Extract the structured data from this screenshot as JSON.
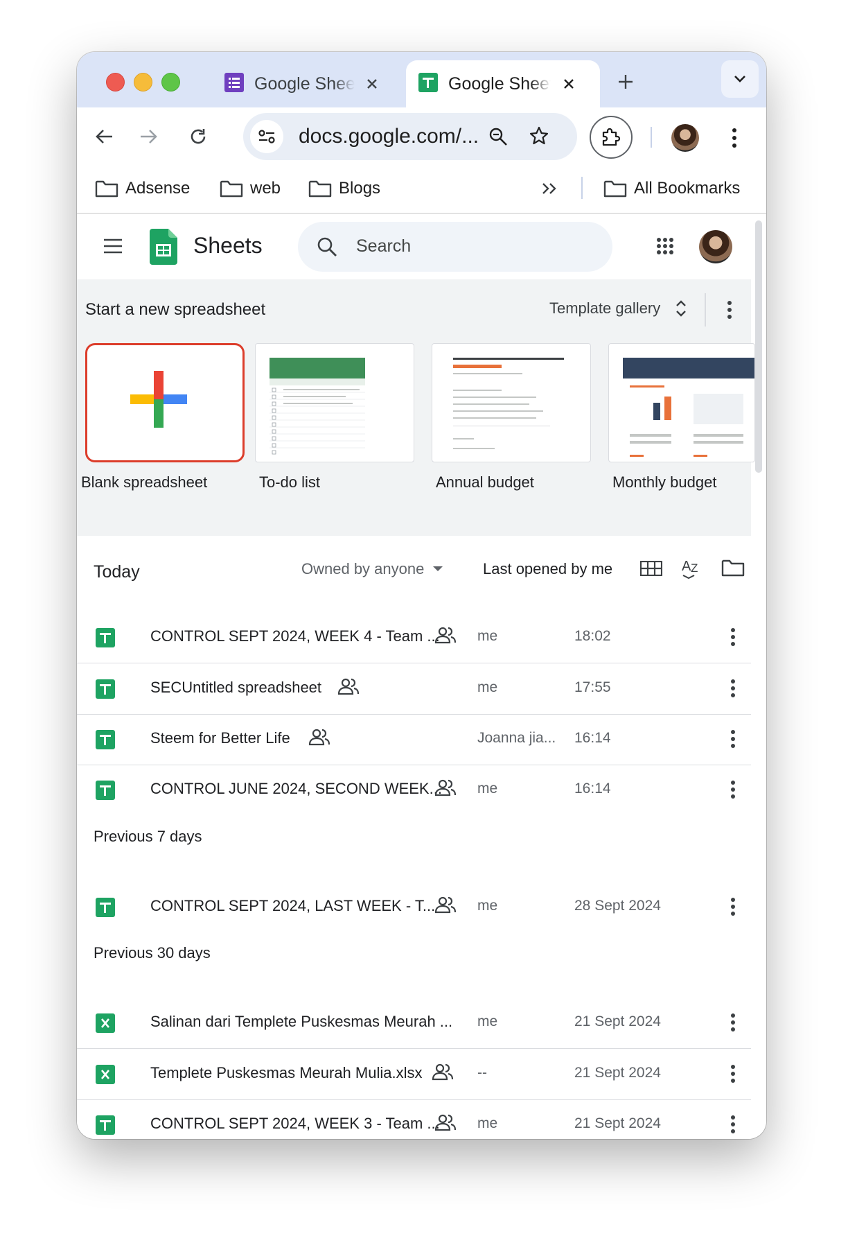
{
  "tabs": [
    {
      "title": "Google Sheets",
      "icon": "google-forms-icon",
      "active": false
    },
    {
      "title": "Google Sheets",
      "icon": "google-sheets-icon",
      "active": true
    }
  ],
  "toolbar": {
    "url": "docs.google.com/..."
  },
  "bookmarks": {
    "items": [
      "Adsense",
      "web",
      "Blogs"
    ],
    "all_bookmarks": "All Bookmarks"
  },
  "app": {
    "name": "Sheets",
    "search_placeholder": "Search"
  },
  "templates": {
    "title": "Start a new spreadsheet",
    "gallery_label": "Template gallery",
    "items": [
      {
        "label": "Blank spreadsheet"
      },
      {
        "label": "To-do list"
      },
      {
        "label": "Annual budget"
      },
      {
        "label": "Monthly budget"
      }
    ]
  },
  "filters": {
    "section": "Today",
    "owned": "Owned by anyone",
    "sort": "Last opened by me"
  },
  "files": {
    "today": [
      {
        "name": "CONTROL SEPT 2024, WEEK 4 - Team ...",
        "owner": "me",
        "opened": "18:02",
        "type": "sheet",
        "shared": true
      },
      {
        "name": "SECUntitled spreadsheet",
        "owner": "me",
        "opened": "17:55",
        "type": "sheet",
        "shared": true
      },
      {
        "name": "Steem for Better Life",
        "owner": "Joanna jia...",
        "opened": "16:14",
        "type": "sheet",
        "shared": true
      },
      {
        "name": "CONTROL JUNE 2024, SECOND WEEK...",
        "owner": "me",
        "opened": "16:14",
        "type": "sheet",
        "shared": true
      }
    ],
    "prev7_label": "Previous 7 days",
    "prev7": [
      {
        "name": "CONTROL SEPT 2024, LAST WEEK - T...",
        "owner": "me",
        "opened": "28 Sept 2024",
        "type": "sheet",
        "shared": true
      }
    ],
    "prev30_label": "Previous 30 days",
    "prev30": [
      {
        "name": "Salinan dari Templete Puskesmas Meurah ...",
        "owner": "me",
        "opened": "21 Sept 2024",
        "type": "xlsx",
        "shared": false
      },
      {
        "name": "Templete Puskesmas Meurah Mulia.xlsx",
        "owner": "--",
        "opened": "21 Sept 2024",
        "type": "xlsx",
        "shared": true
      },
      {
        "name": "CONTROL SEPT 2024, WEEK 3 - Team ...",
        "owner": "me",
        "opened": "21 Sept 2024",
        "type": "sheet",
        "shared": true
      }
    ]
  },
  "colors": {
    "tabstrip": "#dbe4f7",
    "sheets_green": "#1ea362",
    "highlight_red": "#dc3d2b"
  }
}
